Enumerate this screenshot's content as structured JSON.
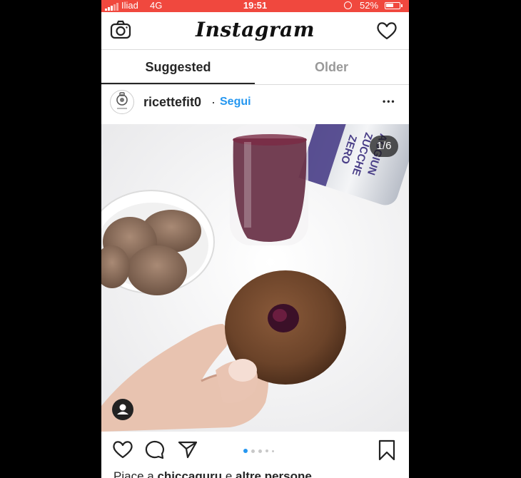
{
  "status_bar": {
    "carrier": "Iliad",
    "network": "4G",
    "time": "19:51",
    "battery": "52%"
  },
  "header": {
    "logo": "Instagram"
  },
  "tabs": [
    {
      "label": "Suggested",
      "active": true
    },
    {
      "label": "Older",
      "active": false
    }
  ],
  "post": {
    "username": "ricettefit0",
    "separator": "·",
    "follow_label": "Segui",
    "more_label": "•••",
    "counter": "1/6",
    "carousel": {
      "current": 1,
      "total": 6
    }
  },
  "likes": {
    "prefix": "Piace a ",
    "user": "chiccaguru",
    "middle": " e ",
    "others": "altre persone"
  },
  "colors": {
    "status_bar": "#f0483e",
    "link_blue": "#2597f0",
    "text": "#262626",
    "inactive_tab": "#999999"
  }
}
